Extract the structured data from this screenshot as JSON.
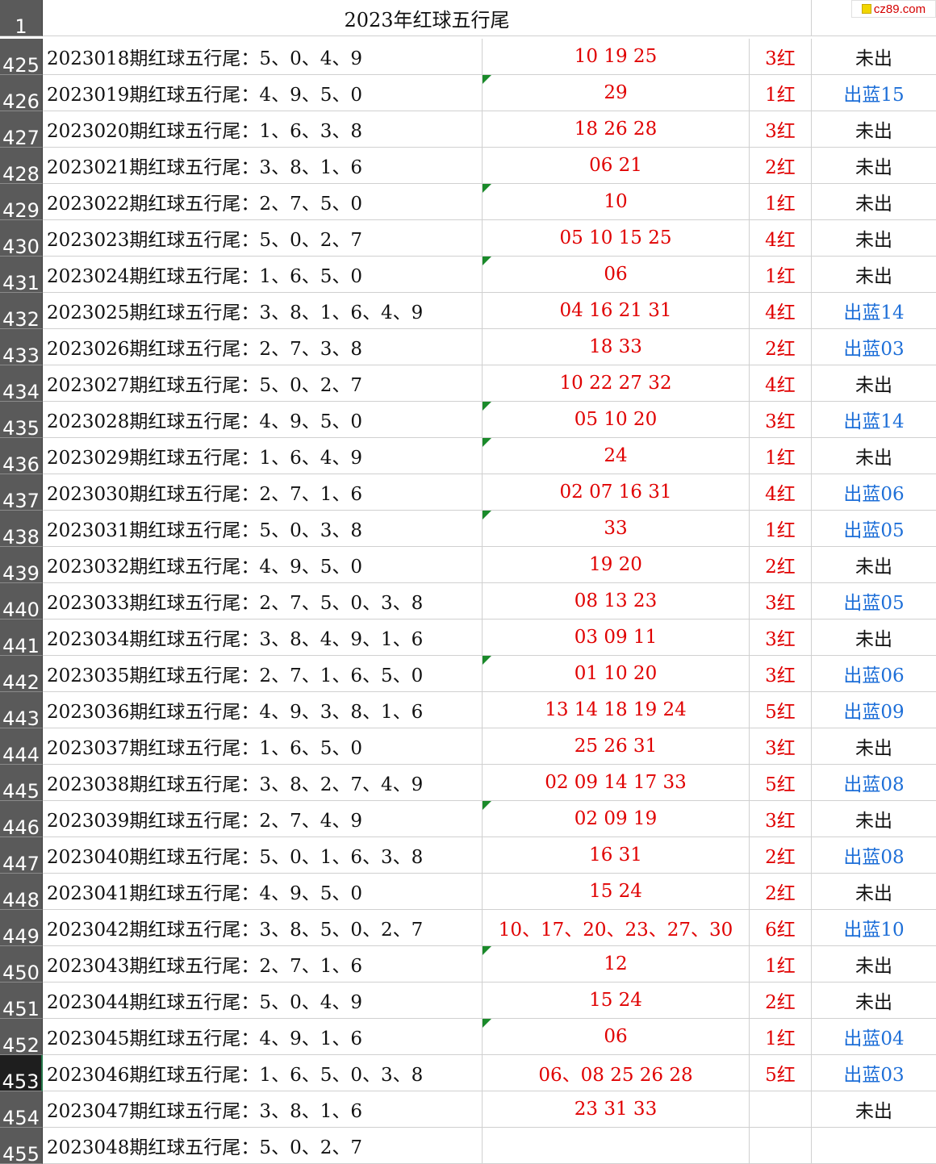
{
  "header": {
    "row_number": "1",
    "title": "2023年红球五行尾"
  },
  "watermark": {
    "text": "cz89.com"
  },
  "rows": [
    {
      "num": "425",
      "issue": "2023018期红球五行尾：5、0、4、9",
      "balls": "10  19  25",
      "count": "3红",
      "blue": "未出",
      "is_blue": false,
      "flag": false
    },
    {
      "num": "426",
      "issue": "2023019期红球五行尾：4、9、5、0",
      "balls": "29",
      "count": "1红",
      "blue": "出蓝15",
      "is_blue": true,
      "flag": true
    },
    {
      "num": "427",
      "issue": "2023020期红球五行尾：1、6、3、8",
      "balls": "18  26  28",
      "count": "3红",
      "blue": "未出",
      "is_blue": false,
      "flag": false
    },
    {
      "num": "428",
      "issue": "2023021期红球五行尾：3、8、1、6",
      "balls": "06  21",
      "count": "2红",
      "blue": "未出",
      "is_blue": false,
      "flag": false
    },
    {
      "num": "429",
      "issue": "2023022期红球五行尾：2、7、5、0",
      "balls": "10",
      "count": "1红",
      "blue": "未出",
      "is_blue": false,
      "flag": true
    },
    {
      "num": "430",
      "issue": "2023023期红球五行尾：5、0、2、7",
      "balls": "05  10  15  25",
      "count": "4红",
      "blue": "未出",
      "is_blue": false,
      "flag": false
    },
    {
      "num": "431",
      "issue": "2023024期红球五行尾：1、6、5、0",
      "balls": "06",
      "count": "1红",
      "blue": "未出",
      "is_blue": false,
      "flag": true
    },
    {
      "num": "432",
      "issue": "2023025期红球五行尾：3、8、1、6、4、9",
      "balls": "04  16  21  31",
      "count": "4红",
      "blue": "出蓝14",
      "is_blue": true,
      "flag": false
    },
    {
      "num": "433",
      "issue": "2023026期红球五行尾：2、7、3、8",
      "balls": "18  33",
      "count": "2红",
      "blue": "出蓝03",
      "is_blue": true,
      "flag": false
    },
    {
      "num": "434",
      "issue": "2023027期红球五行尾：5、0、2、7",
      "balls": "10  22  27  32",
      "count": "4红",
      "blue": "未出",
      "is_blue": false,
      "flag": false
    },
    {
      "num": "435",
      "issue": "2023028期红球五行尾：4、9、5、0",
      "balls": "05  10  20",
      "count": "3红",
      "blue": "出蓝14",
      "is_blue": true,
      "flag": true
    },
    {
      "num": "436",
      "issue": "2023029期红球五行尾：1、6、4、9",
      "balls": "24",
      "count": "1红",
      "blue": "未出",
      "is_blue": false,
      "flag": true
    },
    {
      "num": "437",
      "issue": "2023030期红球五行尾：2、7、1、6",
      "balls": "02  07  16  31",
      "count": "4红",
      "blue": "出蓝06",
      "is_blue": true,
      "flag": false
    },
    {
      "num": "438",
      "issue": "2023031期红球五行尾：5、0、3、8",
      "balls": "33",
      "count": "1红",
      "blue": "出蓝05",
      "is_blue": true,
      "flag": true
    },
    {
      "num": "439",
      "issue": "2023032期红球五行尾：4、9、5、0",
      "balls": "19  20",
      "count": "2红",
      "blue": "未出",
      "is_blue": false,
      "flag": false
    },
    {
      "num": "440",
      "issue": "2023033期红球五行尾：2、7、5、0、3、8",
      "balls": "08  13  23",
      "count": "3红",
      "blue": "出蓝05",
      "is_blue": true,
      "flag": false
    },
    {
      "num": "441",
      "issue": "2023034期红球五行尾：3、8、4、9、1、6",
      "balls": "03  09  11",
      "count": "3红",
      "blue": "未出",
      "is_blue": false,
      "flag": false
    },
    {
      "num": "442",
      "issue": "2023035期红球五行尾：2、7、1、6、5、0",
      "balls": "01  10  20",
      "count": "3红",
      "blue": "出蓝06",
      "is_blue": true,
      "flag": true
    },
    {
      "num": "443",
      "issue": "2023036期红球五行尾：4、9、3、8、1、6",
      "balls": "13  14  18  19  24",
      "count": "5红",
      "blue": "出蓝09",
      "is_blue": true,
      "flag": false
    },
    {
      "num": "444",
      "issue": "2023037期红球五行尾：1、6、5、0",
      "balls": "25  26  31",
      "count": "3红",
      "blue": "未出",
      "is_blue": false,
      "flag": false
    },
    {
      "num": "445",
      "issue": "2023038期红球五行尾：3、8、2、7、4、9",
      "balls": "02  09  14  17  33",
      "count": "5红",
      "blue": "出蓝08",
      "is_blue": true,
      "flag": false
    },
    {
      "num": "446",
      "issue": "2023039期红球五行尾：2、7、4、9",
      "balls": "02  09  19",
      "count": "3红",
      "blue": "未出",
      "is_blue": false,
      "flag": true
    },
    {
      "num": "447",
      "issue": "2023040期红球五行尾：5、0、1、6、3、8",
      "balls": "16  31",
      "count": "2红",
      "blue": "出蓝08",
      "is_blue": true,
      "flag": false
    },
    {
      "num": "448",
      "issue": "2023041期红球五行尾：4、9、5、0",
      "balls": "15  24",
      "count": "2红",
      "blue": "未出",
      "is_blue": false,
      "flag": false
    },
    {
      "num": "449",
      "issue": "2023042期红球五行尾：3、8、5、0、2、7",
      "balls": "10、17、20、23、27、30",
      "count": "6红",
      "blue": "出蓝10",
      "is_blue": true,
      "flag": false
    },
    {
      "num": "450",
      "issue": "2023043期红球五行尾：2、7、1、6",
      "balls": "12",
      "count": "1红",
      "blue": "未出",
      "is_blue": false,
      "flag": true
    },
    {
      "num": "451",
      "issue": "2023044期红球五行尾：5、0、4、9",
      "balls": "15  24",
      "count": "2红",
      "blue": "未出",
      "is_blue": false,
      "flag": false
    },
    {
      "num": "452",
      "issue": "2023045期红球五行尾：4、9、1、6",
      "balls": "06",
      "count": "1红",
      "blue": "出蓝04",
      "is_blue": true,
      "flag": true
    },
    {
      "num": "453",
      "issue": "2023046期红球五行尾：1、6、5、0、3、8",
      "balls": "06、08  25  26  28",
      "count": "5红",
      "blue": "出蓝03",
      "is_blue": true,
      "flag": false,
      "selected": true
    },
    {
      "num": "454",
      "issue": "2023047期红球五行尾：3、8、1、6",
      "balls": "23  31  33",
      "count": "",
      "blue": "未出",
      "is_blue": false,
      "flag": false
    },
    {
      "num": "455",
      "issue": "2023048期红球五行尾：5、0、2、7",
      "balls": "",
      "count": "",
      "blue": "",
      "is_blue": false,
      "flag": false
    }
  ],
  "colors": {
    "red_text": "#e00000",
    "blue_text": "#1e6fd8",
    "row_header_bg": "#5a5a5a",
    "selected_row_header_bg": "#1e1e1e",
    "flag_green": "#1a8a2a"
  }
}
